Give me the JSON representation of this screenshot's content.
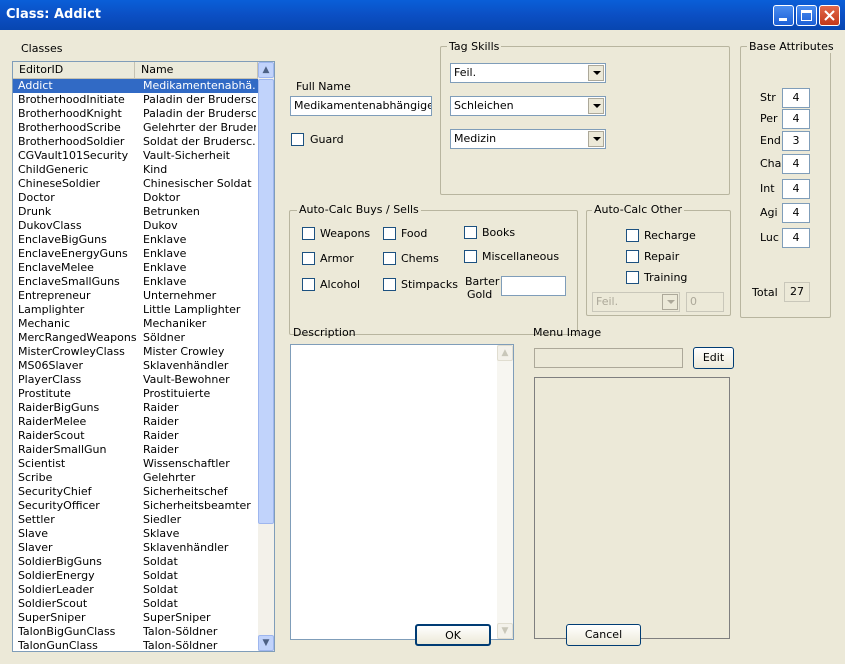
{
  "window": {
    "title": "Class: Addict"
  },
  "classes": {
    "label": "Classes",
    "columns": [
      "EditorID",
      "Name"
    ],
    "rows": [
      [
        "Addict",
        "Medikamentenabhä..."
      ],
      [
        "BrotherhoodInitiate",
        "Paladin der Brudersc..."
      ],
      [
        "BrotherhoodKnight",
        "Paladin der Brudersc..."
      ],
      [
        "BrotherhoodScribe",
        "Gelehrter der Bruder..."
      ],
      [
        "BrotherhoodSoldier",
        "Soldat der Brudersc..."
      ],
      [
        "CGVault101Security",
        "Vault-Sicherheit"
      ],
      [
        "ChildGeneric",
        "Kind"
      ],
      [
        "ChineseSoldier",
        "Chinesischer Soldat"
      ],
      [
        "Doctor",
        "Doktor"
      ],
      [
        "Drunk",
        "Betrunken"
      ],
      [
        "DukovClass",
        "Dukov"
      ],
      [
        "EnclaveBigGuns",
        "Enklave"
      ],
      [
        "EnclaveEnergyGuns",
        "Enklave"
      ],
      [
        "EnclaveMelee",
        "Enklave"
      ],
      [
        "EnclaveSmallGuns",
        "Enklave"
      ],
      [
        "Entrepreneur",
        "Unternehmer"
      ],
      [
        "Lamplighter",
        "Little Lamplighter"
      ],
      [
        "Mechanic",
        "Mechaniker"
      ],
      [
        "MercRangedWeapons",
        "Söldner"
      ],
      [
        "MisterCrowleyClass",
        "Mister Crowley"
      ],
      [
        "MS06Slaver",
        "Sklavenhändler"
      ],
      [
        "PlayerClass",
        "Vault-Bewohner"
      ],
      [
        "Prostitute",
        "Prostituierte"
      ],
      [
        "RaiderBigGuns",
        "Raider"
      ],
      [
        "RaiderMelee",
        "Raider"
      ],
      [
        "RaiderScout",
        "Raider"
      ],
      [
        "RaiderSmallGun",
        "Raider"
      ],
      [
        "Scientist",
        "Wissenschaftler"
      ],
      [
        "Scribe",
        "Gelehrter"
      ],
      [
        "SecurityChief",
        "Sicherheitschef"
      ],
      [
        "SecurityOfficer",
        "Sicherheitsbeamter"
      ],
      [
        "Settler",
        "Siedler"
      ],
      [
        "Slave",
        "Sklave"
      ],
      [
        "Slaver",
        "Sklavenhändler"
      ],
      [
        "SoldierBigGuns",
        "Soldat"
      ],
      [
        "SoldierEnergy",
        "Soldat"
      ],
      [
        "SoldierLeader",
        "Soldat"
      ],
      [
        "SoldierScout",
        "Soldat"
      ],
      [
        "SuperSniper",
        "SuperSniper"
      ],
      [
        "TalonBigGunClass",
        "Talon-Söldner"
      ],
      [
        "TalonGunClass",
        "Talon-Söldner"
      ]
    ],
    "selected_index": 0
  },
  "full_name": {
    "label": "Full Name",
    "value": "Medikamentenabhängiger"
  },
  "guard": {
    "label": "Guard"
  },
  "tag_skills": {
    "label": "Tag Skills",
    "skills": [
      "Feil.",
      "Schleichen",
      "Medizin"
    ]
  },
  "base_attributes": {
    "label": "Base Attributes",
    "items": [
      {
        "name": "Str",
        "value": "4"
      },
      {
        "name": "Per",
        "value": "4"
      },
      {
        "name": "End",
        "value": "3"
      },
      {
        "name": "Cha",
        "value": "4"
      },
      {
        "name": "Int",
        "value": "4"
      },
      {
        "name": "Agi",
        "value": "4"
      },
      {
        "name": "Luc",
        "value": "4"
      }
    ],
    "total_label": "Total",
    "total_value": "27"
  },
  "auto_calc_buys": {
    "label": "Auto-Calc Buys / Sells",
    "weapons": "Weapons",
    "food": "Food",
    "books": "Books",
    "armor": "Armor",
    "chems": "Chems",
    "misc": "Miscellaneous",
    "alcohol": "Alcohol",
    "stimpacks": "Stimpacks",
    "barter_gold_1": "Barter",
    "barter_gold_2": "Gold"
  },
  "auto_calc_other": {
    "label": "Auto-Calc Other",
    "recharge": "Recharge",
    "repair": "Repair",
    "training": "Training",
    "skill_value": "Feil.",
    "skill_amount": "0"
  },
  "description": {
    "label": "Description"
  },
  "menu_image": {
    "label": "Menu Image",
    "edit_label": "Edit"
  },
  "buttons": {
    "ok": "OK",
    "cancel": "Cancel"
  }
}
